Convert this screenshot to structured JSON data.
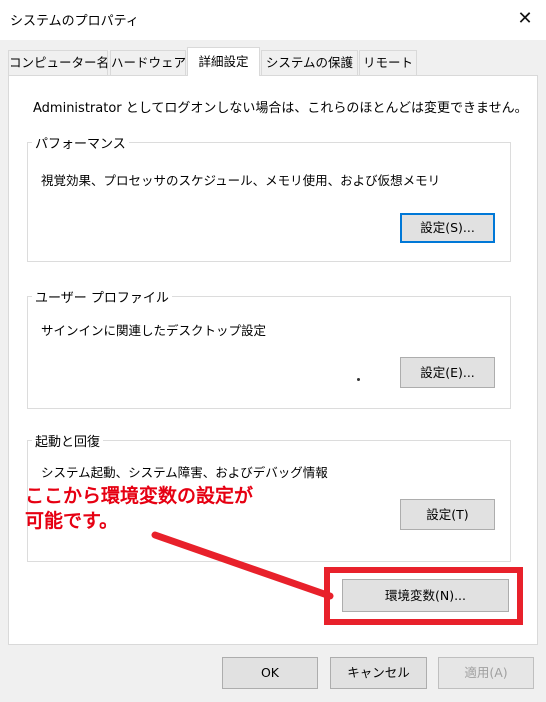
{
  "window": {
    "title": "システムのプロパティ",
    "close_glyph": "✕"
  },
  "tabs": [
    {
      "label": "コンピューター名"
    },
    {
      "label": "ハードウェア"
    },
    {
      "label": "詳細設定"
    },
    {
      "label": "システムの保護"
    },
    {
      "label": "リモート"
    }
  ],
  "active_tab": "詳細設定",
  "panel": {
    "admin_note": "Administrator としてログオンしない場合は、これらのほとんどは変更できません。",
    "performance": {
      "legend": "パフォーマンス",
      "description": "視覚効果、プロセッサのスケジュール、メモリ使用、および仮想メモリ",
      "button_label": "設定(S)...",
      "button_mnemonic_letter": "S"
    },
    "user_profiles": {
      "legend": "ユーザー プロファイル",
      "description": "サインインに関連したデスクトップ設定",
      "button_label": "設定(E)...",
      "button_mnemonic_letter": "E"
    },
    "startup_recovery": {
      "legend": "起動と回復",
      "description": "システム起動、システム障害、およびデバッグ情報",
      "button_label": "設定(T)",
      "button_mnemonic_letter": "T"
    },
    "env_button_label": "環境変数(N)...",
    "env_button_mnemonic_letter": "N"
  },
  "annotation": {
    "line1": "ここから環境変数の設定が",
    "line2": "可能です。",
    "color": "#e60012"
  },
  "footer": {
    "ok_label": "OK",
    "cancel_label": "キャンセル",
    "apply_label": "適用(A)",
    "apply_mnemonic_letter": "A"
  },
  "colors": {
    "dialog_bg": "#f0f0f0",
    "button_bg": "#e1e1e1",
    "focus_border": "#0078d7",
    "highlight_red": "#e8212b"
  }
}
